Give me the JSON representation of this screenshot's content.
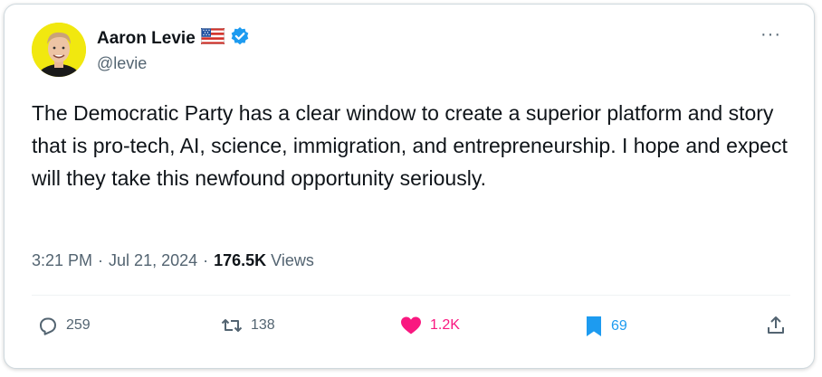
{
  "author": {
    "name": "Aaron Levie",
    "handle": "@levie",
    "flag_icon": "us-flag-icon",
    "verified_icon": "verified-badge-icon",
    "verified_color": "#1d9bf0"
  },
  "more_label": "···",
  "tweet": {
    "text": "The Democratic Party has a clear window to create a superior platform and story that is pro-tech, AI, science, immigration, and entrepreneurship. I hope and expect will they take this newfound opportunity seriously."
  },
  "meta": {
    "time": "3:21 PM",
    "separator": "·",
    "date": "Jul 21, 2024",
    "views_count": "176.5K",
    "views_label": "Views"
  },
  "actions": {
    "replies": "259",
    "reposts": "138",
    "likes": "1.2K",
    "bookmarks": "69"
  },
  "colors": {
    "like": "#f91880",
    "bookmark": "#1d9bf0",
    "muted": "#536471"
  }
}
